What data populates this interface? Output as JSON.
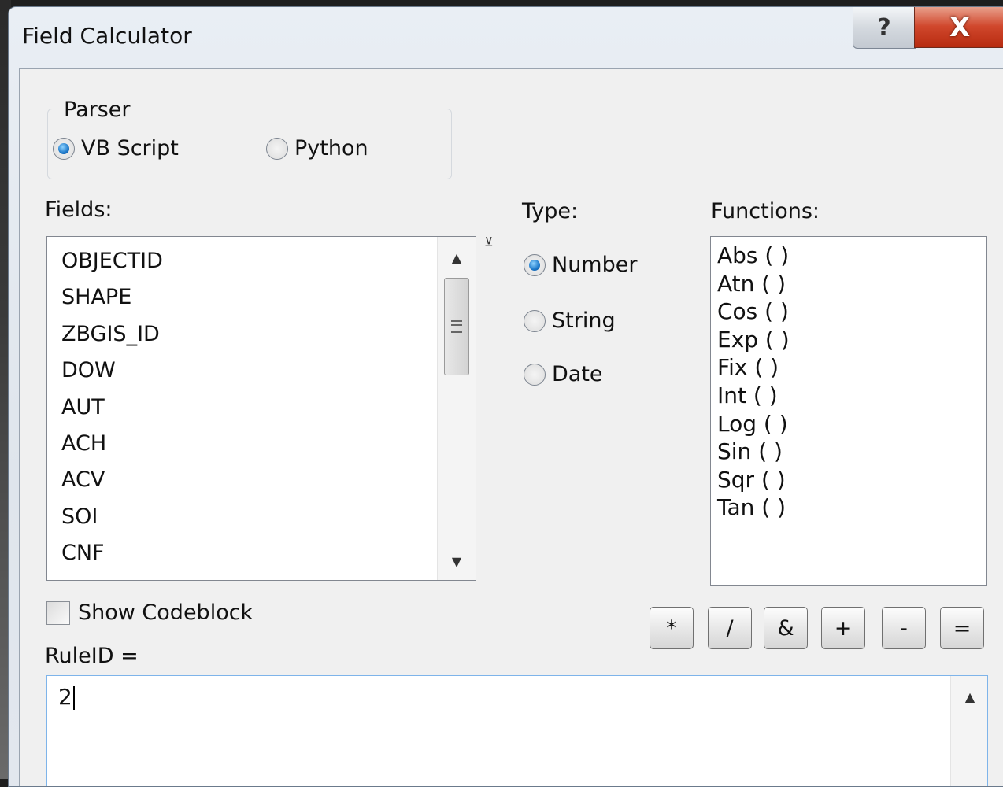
{
  "window": {
    "title": "Field Calculator",
    "help_label": "?",
    "close_label": "X"
  },
  "parser": {
    "label": "Parser",
    "options": [
      {
        "label": "VB Script",
        "selected": true
      },
      {
        "label": "Python",
        "selected": false
      }
    ]
  },
  "fields": {
    "label": "Fields:",
    "items": [
      "OBJECTID",
      "SHAPE",
      "ZBGIS_ID",
      "DOW",
      "AUT",
      "ACH",
      "ACV",
      "SOI",
      "CNF"
    ]
  },
  "type": {
    "label": "Type:",
    "options": [
      {
        "label": "Number",
        "selected": true
      },
      {
        "label": "String",
        "selected": false
      },
      {
        "label": "Date",
        "selected": false
      }
    ]
  },
  "functions": {
    "label": "Functions:",
    "items": [
      "Abs ( )",
      "Atn ( )",
      "Cos ( )",
      "Exp ( )",
      "Fix ( )",
      "Int ( )",
      "Log ( )",
      "Sin ( )",
      "Sqr ( )",
      "Tan ( )"
    ]
  },
  "codeblock": {
    "label": "Show Codeblock",
    "checked": false
  },
  "operators": [
    "*",
    "/",
    "&",
    "+",
    "-",
    "="
  ],
  "expression": {
    "label": "RuleID =",
    "value": "2"
  }
}
